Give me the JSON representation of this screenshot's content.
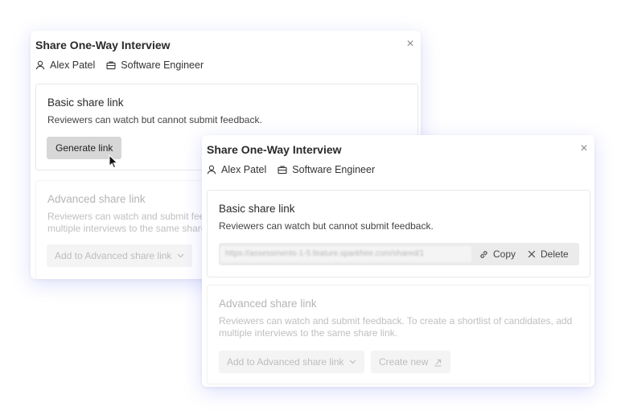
{
  "back_dialog": {
    "title": "Share One-Way Interview",
    "candidate": "Alex Patel",
    "role": "Software Engineer",
    "basic": {
      "title": "Basic share link",
      "description": "Reviewers can watch but cannot submit feedback.",
      "generate_label": "Generate link"
    },
    "advanced": {
      "title": "Advanced share link",
      "desc_line1": "Reviewers can watch and submit feed",
      "desc_line2": "multiple interviews to the same share",
      "add_label": "Add to Advanced share link"
    }
  },
  "front_dialog": {
    "title": "Share One-Way Interview",
    "candidate": "Alex Patel",
    "role": "Software Engineer",
    "basic": {
      "title": "Basic share link",
      "description": "Reviewers can watch but cannot submit feedback.",
      "link_url": "https://assessments-1-5.feature.sparkhire.com/shared/1",
      "copy_label": "Copy",
      "delete_label": "Delete"
    },
    "advanced": {
      "title": "Advanced share link",
      "desc_line1": "Reviewers can watch and submit feedback. To create a shortlist of candidates, add",
      "desc_line2": "multiple interviews to the same share link.",
      "add_label": "Add to Advanced share link",
      "create_label": "Create new"
    }
  },
  "icons": {
    "close": "close-icon",
    "person": "person-icon",
    "briefcase": "briefcase-icon",
    "link": "link-icon",
    "chevron": "chevron-down-icon",
    "external": "external-link-icon",
    "cursor": "mouse-cursor-icon"
  }
}
